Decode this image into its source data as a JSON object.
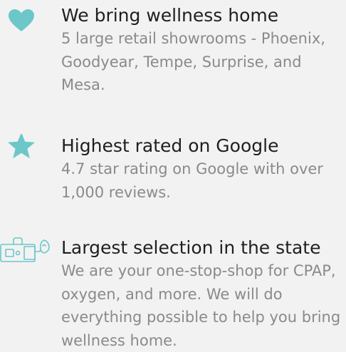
{
  "colors": {
    "accent": "#6cc7c9",
    "title": "#1f1f1f",
    "text": "#8a8a8a",
    "background": "#f2f2f2"
  },
  "features": [
    {
      "icon": "heart-icon",
      "title": "We bring wellness home",
      "description": "5 large retail showrooms - Phoenix, Goodyear, Tempe, Surprise, and Mesa."
    },
    {
      "icon": "star-icon",
      "title": "Highest rated on Google",
      "description": "4.7 star rating on Google with over 1,000 reviews."
    },
    {
      "icon": "oxygen-concentrator-icon",
      "title": "Largest selection in the state",
      "description": "We are your one-stop-shop for CPAP, oxygen, and more. We will do everything possible to help you bring wellness home."
    }
  ]
}
